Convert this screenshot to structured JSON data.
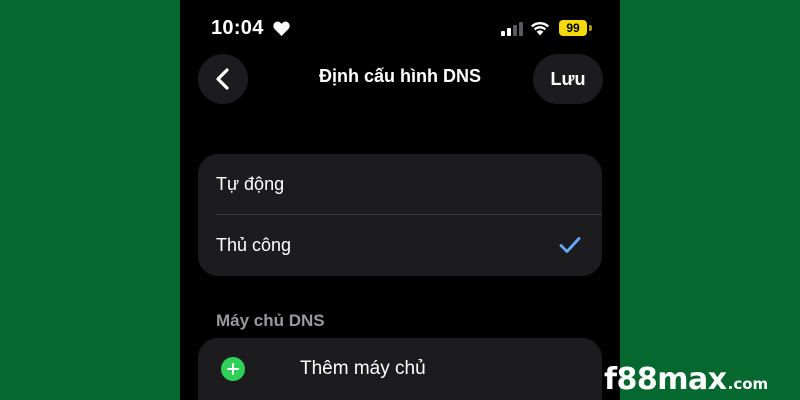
{
  "status_bar": {
    "time": "10:04",
    "battery": "99",
    "icons": [
      "heart-icon",
      "signal-icon",
      "wifi-icon",
      "battery-icon"
    ]
  },
  "nav": {
    "back_icon": "chevron-left-icon",
    "title": "Định cấu hình DNS",
    "save_label": "Lưu"
  },
  "dns_mode": {
    "options": [
      {
        "label": "Tự động",
        "selected": false
      },
      {
        "label": "Thủ công",
        "selected": true
      }
    ],
    "check_icon": "checkmark-icon"
  },
  "dns_servers": {
    "header": "Máy chủ DNS",
    "add_label": "Thêm máy chủ",
    "add_icon": "plus-circle-icon"
  },
  "watermark": {
    "main": "f88max",
    "suffix": ".com"
  },
  "colors": {
    "background": "#05692f",
    "screen": "#000000",
    "card": "#1c1c1e",
    "accent_check": "#64a9ff",
    "add_green": "#30d158",
    "battery": "#f5d90a"
  }
}
